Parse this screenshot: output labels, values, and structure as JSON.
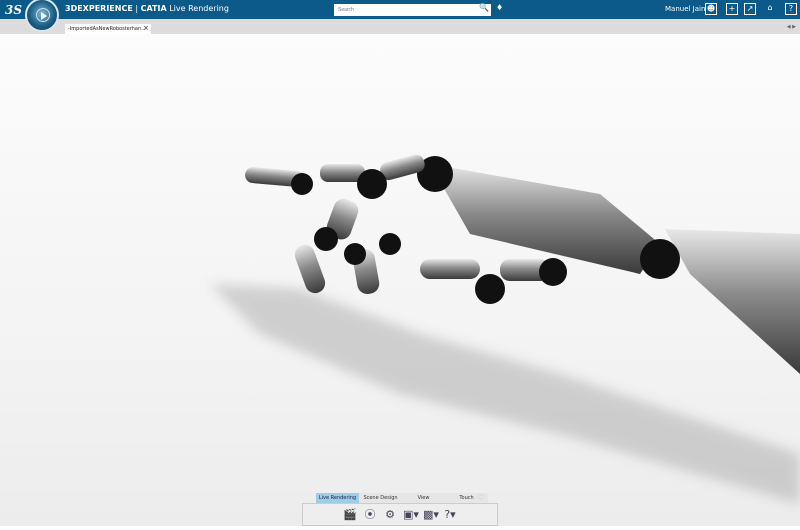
{
  "header": {
    "brand": "3DEXPERIENCE",
    "separator": " | ",
    "app": "CATIA",
    "app_suffix": " Live Rendering",
    "search_placeholder": "Search",
    "user": "Manuel Jain",
    "icons": [
      "user-icon",
      "add-icon",
      "share-icon",
      "home-icon",
      "help-icon"
    ]
  },
  "tabs": [
    {
      "label": "-ImportedAsNewRobosterhan...",
      "close": "×"
    }
  ],
  "tab_nav": "◀ ▶",
  "action_bar": {
    "tabs": [
      "Live Rendering",
      "Scene Design",
      "View",
      "Touch"
    ],
    "active": "Live Rendering",
    "favorite": "♡",
    "tools": [
      "clapperboard-icon",
      "render-icon",
      "settings-icon",
      "environment-icon",
      "camera-icon",
      "help-icon"
    ]
  },
  "colors": {
    "header": "#0c5a8a",
    "active_tab": "#9fcde8"
  }
}
